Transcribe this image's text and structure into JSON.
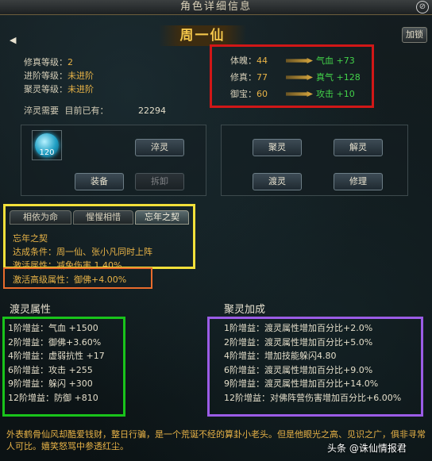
{
  "window": {
    "title": "角色详细信息",
    "lock_label": "加锁"
  },
  "character": {
    "name": "周一仙"
  },
  "info": {
    "xiuzhen_label": "修真等级：",
    "xiuzhen_value": "2",
    "jinjie_label": "进阶等级：",
    "jinjie_value": "未进阶",
    "julingdj_label": "聚灵等级：",
    "julingdj_value": "未进阶",
    "cuiling_need_label": "淬灵需要",
    "current_label": "目前已有：",
    "current_value": "22294"
  },
  "stats": [
    {
      "label": "体魄：",
      "value": "44",
      "gain_label": "气血",
      "gain": "+73"
    },
    {
      "label": "修真：",
      "value": "77",
      "gain_label": "真气",
      "gain": "+128"
    },
    {
      "label": "御宝：",
      "value": "60",
      "gain_label": "攻击",
      "gain": "+10"
    }
  ],
  "gem": {
    "count": "120"
  },
  "buttons": {
    "cuiling": "淬灵",
    "zhuangbei": "装备",
    "chaixie": "拆卸",
    "juling": "聚灵",
    "jieling": "解灵",
    "duling": "渡灵",
    "xiuli": "修理"
  },
  "tabs": [
    "相依为命",
    "惺惺相惜",
    "忘年之契"
  ],
  "bond": {
    "name": "忘年之契",
    "condition": "达成条件：周一仙、张小凡同时上阵",
    "effect": "激活属性：减免伤害 1.40%",
    "advanced": "激活高级属性：御佛+4.00%"
  },
  "duling_section": {
    "title": "渡灵属性",
    "rows": [
      "1阶增益：气血 +1500",
      "2阶增益：御佛+3.60%",
      "4阶增益：虚弱抗性 +17",
      "6阶增益：攻击 +255",
      "9阶增益：躲闪 +300",
      "12阶增益：防御 +810"
    ]
  },
  "juling_section": {
    "title": "聚灵加成",
    "rows": [
      "1阶增益：渡灵属性增加百分比+2.0%",
      "2阶增益：渡灵属性增加百分比+5.0%",
      "4阶增益：增加技能躲闪4.80",
      "6阶增益：渡灵属性增加百分比+9.0%",
      "9阶增益：渡灵属性增加百分比+14.0%",
      "12阶增益：对佛阵营伤害增加百分比+6.00%"
    ]
  },
  "lore": "外表鹤骨仙风却酷爱钱财，整日行骗，是一个荒诞不经的算卦小老头。但是他眼光之高、见识之广，俱非寻常人可比。嬉笑怒骂中参透红尘。",
  "watermark": "头条 @诛仙情报君"
}
